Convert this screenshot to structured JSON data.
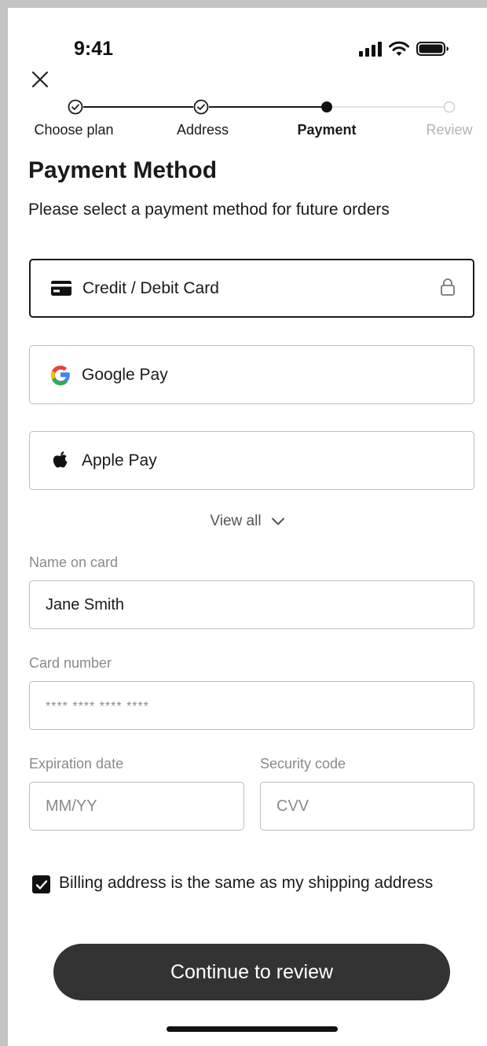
{
  "status_bar": {
    "time": "9:41",
    "icons": [
      "signal-icon",
      "wifi-icon",
      "battery-icon"
    ]
  },
  "header": {
    "close_icon": "close-icon"
  },
  "stepper": {
    "steps": [
      {
        "label": "Choose plan",
        "state": "completed"
      },
      {
        "label": "Address",
        "state": "completed"
      },
      {
        "label": "Payment",
        "state": "current"
      },
      {
        "label": "Review",
        "state": "upcoming"
      }
    ]
  },
  "page": {
    "title": "Payment Method",
    "subtitle": "Please select a payment method for future orders"
  },
  "payment_options": [
    {
      "label": "Credit / Debit Card",
      "icon": "credit-card-icon",
      "selected": true,
      "trailing_icon": "lock-icon"
    },
    {
      "label": "Google Pay",
      "icon": "google-icon",
      "selected": false
    },
    {
      "label": "Apple Pay",
      "icon": "apple-icon",
      "selected": false
    }
  ],
  "view_all": {
    "label": "View all",
    "icon": "chevron-down-icon"
  },
  "form": {
    "name_on_card": {
      "label": "Name on card",
      "value": "Jane Smith",
      "placeholder": ""
    },
    "card_number": {
      "label": "Card number",
      "value": "",
      "placeholder": "**** **** **** ****"
    },
    "expiration": {
      "label": "Expiration date",
      "value": "",
      "placeholder": "MM/YY"
    },
    "security_code": {
      "label": "Security code",
      "value": "",
      "placeholder": "CVV"
    }
  },
  "billing": {
    "label": "Billing address is the same as my shipping address",
    "checked": true
  },
  "cta": {
    "label": "Continue to review"
  },
  "colors": {
    "primary": "#333333",
    "border": "#bdbdbd",
    "selected_border": "#1a1a1a",
    "muted_text": "#8a8a8a",
    "google_blue": "#4285F4",
    "google_red": "#EA4335",
    "google_yellow": "#FBBC05",
    "google_green": "#34A853"
  }
}
